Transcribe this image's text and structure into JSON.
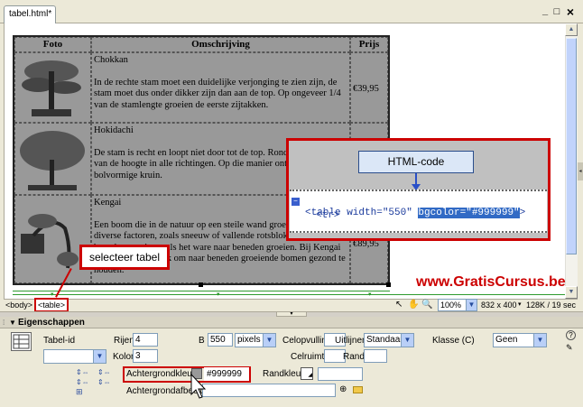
{
  "document": {
    "tab_label": "tabel.html*"
  },
  "window_controls": {
    "minimize": "_",
    "restore": "□",
    "close": "×"
  },
  "table": {
    "headers": [
      "Foto",
      "Omschrijving",
      "Prijs"
    ],
    "rows": [
      {
        "name": "Chokkan",
        "desc": "In de rechte stam moet een duidelijke verjonging te zien zijn, de stam moet dus onder dikker zijn dan aan de top. Op ongeveer 1/4 van de stamlengte groeien de eerste zijtakken.",
        "price": "€39,95"
      },
      {
        "name": "Hokidachi",
        "desc": "De stam is recht en loopt niet door tot de top. Rond ongeveer 1/3 van de hoogte in alle richtingen. Op die manier ontstaat een bolvormige kruin.",
        "price": ""
      },
      {
        "name": "Kengai",
        "desc": "Een boom die in de natuur op een steile wand groeit en door diverse factoren, zoals sneeuw of vallende rotsblokken, naar beneden groeit, zo als het ware naar beneden groeien. Bij Kengai is het bijna mogelijk om naar beneden groeiende bomen gezond te houden.",
        "price": "€89,95"
      }
    ]
  },
  "callouts": {
    "html_code_label": "HTML-code",
    "code_line1_a": "<table width=\"550\" ",
    "code_line1_b": "bgcolor=\"#999999\"",
    "code_line1_c": ">",
    "code_line2": "<tr>",
    "selecteer_tabel": "selecteer tabel",
    "watermark": "www.GratisCursus.be"
  },
  "status_bar": {
    "tag_body": "<body>",
    "tag_table": "<table>",
    "zoom": "100%",
    "size": "832 x 400",
    "file_info": "128K / 19 sec"
  },
  "properties": {
    "panel_title": "Eigenschappen",
    "tabel_id_label": "Tabel-id",
    "rijen_label": "Rijen",
    "rijen_value": "4",
    "b_label": "B",
    "b_value": "550",
    "b_unit": "pixels",
    "celopvulling_label": "Celopvulling",
    "uitlijnen_label": "Uitlijnen",
    "uitlijnen_value": "Standaard",
    "klasse_label": "Klasse (C)",
    "klasse_value": "Geen",
    "kolommen_label": "Kolommen",
    "kolommen_value": "3",
    "celruimte_label": "Celruimte",
    "rand_label": "Rand",
    "achtergrondkleur_label": "Achtergrondkleur",
    "achtergrondkleur_value": "#999999",
    "randkleur_label": "Randkleur",
    "achtergrondafbeelding_label": "Achtergrondafbeelding"
  },
  "colors": {
    "accent_red": "#cc0000",
    "table_bg": "#999999",
    "selection_blue": "#316ac5"
  }
}
